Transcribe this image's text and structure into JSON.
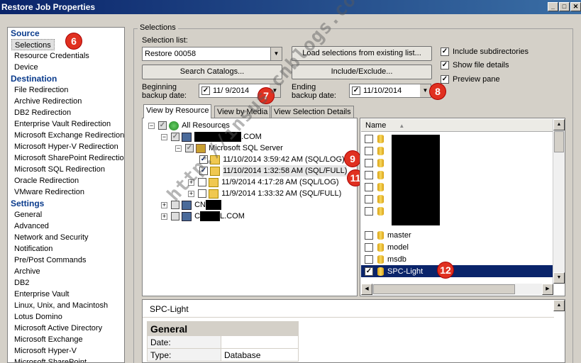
{
  "window": {
    "title": "Restore Job Properties"
  },
  "nav": {
    "source_header": "Source",
    "source_items": [
      "Selections",
      "Resource Credentials",
      "Device"
    ],
    "destination_header": "Destination",
    "destination_items": [
      "File Redirection",
      "Archive Redirection",
      "DB2 Redirection",
      "Enterprise Vault Redirection",
      "Microsoft Exchange Redirection",
      "Microsoft Hyper-V Redirection",
      "Microsoft SharePoint Redirection",
      "Microsoft SQL Redirection",
      "Oracle Redirection",
      "VMware Redirection"
    ],
    "settings_header": "Settings",
    "settings_items": [
      "General",
      "Advanced",
      "Network and Security",
      "Notification",
      "Pre/Post Commands",
      "Archive",
      "DB2",
      "Enterprise Vault",
      "Linux, Unix, and Macintosh",
      "Lotus Domino",
      "Microsoft Active Directory",
      "Microsoft Exchange",
      "Microsoft Hyper-V",
      "Microsoft SharePoint"
    ]
  },
  "selections": {
    "group_label": "Selections",
    "list_label": "Selection list:",
    "list_value": "Restore 00058",
    "load_button": "Load selections from existing list...",
    "search_button": "Search Catalogs...",
    "include_button": "Include/Exclude...",
    "opt_subdirs": "Include subdirectories",
    "opt_details": "Show file details",
    "opt_preview": "Preview pane",
    "begin_label_1": "Beginning",
    "begin_label_2": "backup date:",
    "begin_date": "11/  9/2014",
    "end_label_1": "Ending",
    "end_label_2": "backup date:",
    "end_date": "11/10/2014"
  },
  "tabs": [
    "View by Resource",
    "View by Media",
    "View Selection Details"
  ],
  "tree": {
    "root": "All Resources",
    "server_suffix": ".COM",
    "sql": "Microsoft SQL Server",
    "backups": [
      "11/10/2014 3:59:42 AM (SQL/LOG)",
      "11/10/2014 1:32:58 AM (SQL/FULL)",
      "11/9/2014 4:17:28 AM (SQL/LOG)",
      "11/9/2014 1:33:32 AM (SQL/FULL)"
    ],
    "node2_prefix": "CN",
    "node3_prefix": "C",
    "node3_suffix": "L.COM"
  },
  "list": {
    "column_name": "Name",
    "items": [
      "master",
      "model",
      "msdb",
      "SPC-Light"
    ]
  },
  "preview": {
    "title": "SPC-Light",
    "section": "General",
    "rows": [
      {
        "k": "Date:",
        "v": ""
      },
      {
        "k": "Type:",
        "v": "Database"
      }
    ]
  },
  "badges": [
    "6",
    "7",
    "8",
    "9",
    "11",
    "12"
  ],
  "watermark": "http://insus.cnblogs.com",
  "colors": {
    "nav_header": "#0a3b8c",
    "badge": "#e03020",
    "selection": "#0a246a"
  }
}
